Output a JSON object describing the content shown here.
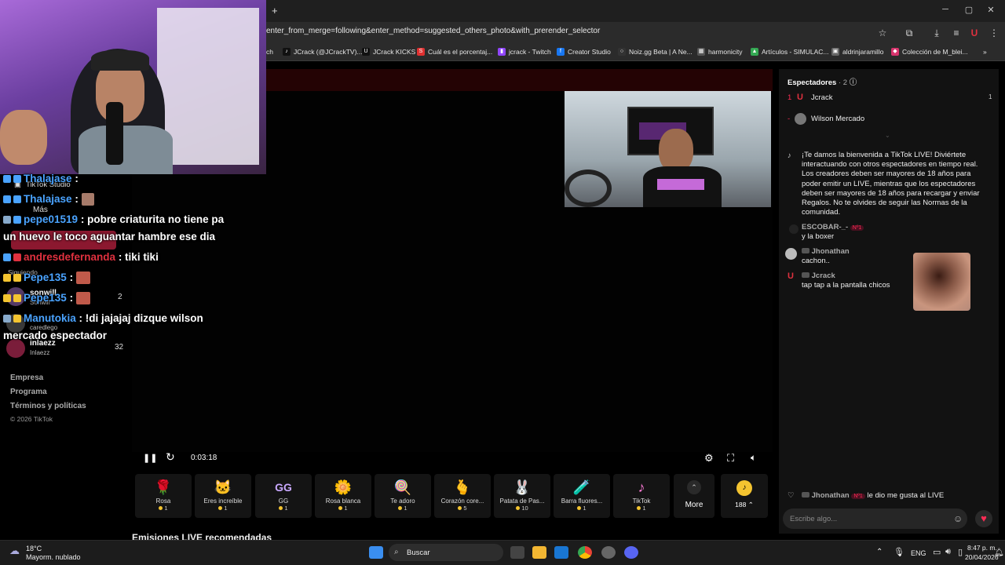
{
  "browser": {
    "new_tab_symbol": "+",
    "url": "enter_from_merge=following&enter_method=suggested_others_photo&with_prerender_selector",
    "window_controls": [
      "─",
      "▢",
      "✕"
    ],
    "bookmarks": [
      {
        "label": "ch",
        "color": "#444"
      },
      {
        "label": "JCrack (@JCrackTV)...",
        "color": "#111"
      },
      {
        "label": "JCrack KICKS",
        "color": "#53fc18"
      },
      {
        "label": "Cuál es el porcentaj...",
        "color": "#e03131"
      },
      {
        "label": "jcrack - Twitch",
        "color": "#9146ff"
      },
      {
        "label": "Creator Studio",
        "color": "#1877f2"
      },
      {
        "label": "Noiz.gg Beta | A Ne...",
        "color": "#333"
      },
      {
        "label": "harmonicity",
        "color": "#555"
      },
      {
        "label": "Artículos - SIMULAC...",
        "color": "#34a853"
      },
      {
        "label": "aldrinjaramillo",
        "color": "#666"
      },
      {
        "label": "Colección de M_blei...",
        "color": "#d6336c"
      }
    ],
    "more_bookmarks": "»"
  },
  "sidebar": {
    "tiktok_studio": "TikTok Studio",
    "mas": "Más",
    "siguiendo": "Siguiendo",
    "following": [
      {
        "name": "sonwill",
        "sub": "Sonwill",
        "count": "2"
      },
      {
        "name": "caredlego",
        "sub": "caredlego",
        "count": ""
      },
      {
        "name": "inlaezz",
        "sub": "Inlaezz",
        "count": "32"
      }
    ],
    "footer_links": [
      "Empresa",
      "Programa",
      "Términos y políticas"
    ],
    "copyright": "© 2026 TikTok"
  },
  "overlay_chat": [
    {
      "user": "Thalajase",
      "text": ":"
    },
    {
      "user": "Thalajase",
      "text": ":"
    },
    {
      "user": "pepe01519",
      "text": ": pobre criaturita no tiene pa"
    },
    {
      "user": "",
      "text": "un huevo le toco aguantar hambre ese dia"
    },
    {
      "user": "andresdefernanda",
      "text": ": tiki tiki"
    },
    {
      "user": "Pepe135",
      "text": ":"
    },
    {
      "user": "Pepe135",
      "text": ":"
    },
    {
      "user": "Manutokia",
      "text": ": !di jajajaj dizque wilson"
    },
    {
      "user": "",
      "text": "mercado espectador"
    }
  ],
  "player": {
    "time": "0:03:18",
    "pause_icon": "❚❚",
    "refresh_icon": "↻"
  },
  "gifts": [
    {
      "name": "Rosa",
      "price": "1",
      "icon": "🌹"
    },
    {
      "name": "Eres increíble",
      "price": "1",
      "icon": "🐱"
    },
    {
      "name": "GG",
      "price": "1",
      "icon": "GG"
    },
    {
      "name": "Rosa blanca",
      "price": "1",
      "icon": "🌼"
    },
    {
      "name": "Te adoro",
      "price": "1",
      "icon": "🍭"
    },
    {
      "name": "Corazón core...",
      "price": "5",
      "icon": "🫰"
    },
    {
      "name": "Patata de Pas...",
      "price": "10",
      "icon": "🐰"
    },
    {
      "name": "Barra fluores...",
      "price": "1",
      "icon": "🧪"
    },
    {
      "name": "TikTok",
      "price": "1",
      "icon": "♪"
    }
  ],
  "gifts_more": "More",
  "coins": "188",
  "recommended": "Emisiones LIVE recomendadas",
  "panel": {
    "viewers_title": "Espectadores",
    "viewers_count": "· 2",
    "viewers": [
      {
        "rank": "1",
        "name": "Jcrack",
        "score": "1"
      },
      {
        "rank": "-",
        "name": "Wilson Mercado",
        "score": ""
      }
    ],
    "welcome": "¡Te damos la bienvenida a TikTok LIVE! Diviértete interactuando con otros espectadores en tiempo real. Los creadores deben ser mayores de 18 años para poder emitir un LIVE, mientras que los espectadores deben ser mayores de 18 años para recargar y enviar Regalos. No te olvides de seguir las Normas de la comunidad.",
    "messages": [
      {
        "user": "ESCOBAR-_-",
        "badge": "Nº1",
        "text": "y la boxer"
      },
      {
        "user": "Jhonathan",
        "badge": "",
        "text": "cachon.."
      },
      {
        "user": "Jcrack",
        "badge": "",
        "text": "tap tap a la pantalla chicos"
      }
    ],
    "like_event": {
      "user": "Jhonathan",
      "badge": "Nº1",
      "text": "le dio me gusta al LIVE"
    },
    "input_placeholder": "Escribe algo..."
  },
  "taskbar": {
    "weather_temp": "18°C",
    "weather_desc": "Mayorm. nublado",
    "search": "Buscar",
    "lang": "ENG",
    "time": "8:47 p. m.",
    "date": "20/04/2026"
  },
  "colors": {
    "accent": "#fe2c55",
    "link_blue": "#4aa3ff",
    "name_red": "#e0313f"
  }
}
